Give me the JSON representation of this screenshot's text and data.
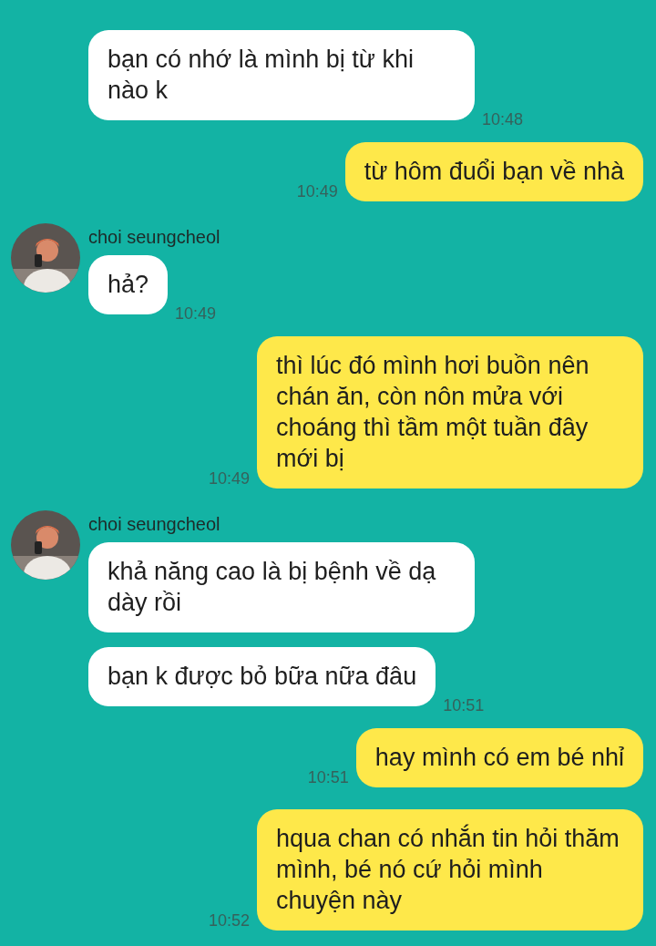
{
  "messages": [
    {
      "kind": "incoming",
      "text": "bạn có nhớ là mình bị từ khi nào k",
      "time": "10:48"
    },
    {
      "kind": "outgoing",
      "text": "từ hôm đuổi bạn về nhà",
      "time": "10:49"
    },
    {
      "kind": "incoming",
      "sender": "choi seungcheol",
      "text": "hả?",
      "time": "10:49"
    },
    {
      "kind": "outgoing",
      "text": "thì lúc đó mình hơi buồn nên chán ăn, còn nôn mửa với choáng thì tầm một tuần đây mới bị",
      "time": "10:49"
    },
    {
      "kind": "incoming",
      "sender": "choi seungcheol",
      "text": "khả năng cao là bị bệnh về dạ dày rồi"
    },
    {
      "kind": "incoming",
      "text": "bạn k được bỏ bữa nữa đâu",
      "time": "10:51"
    },
    {
      "kind": "outgoing",
      "text": "hay mình có em bé nhỉ",
      "time": "10:51"
    },
    {
      "kind": "outgoing",
      "text": "hqua chan có nhắn tin hỏi thăm mình, bé nó cứ hỏi mình chuyện này",
      "time": "10:52"
    }
  ]
}
